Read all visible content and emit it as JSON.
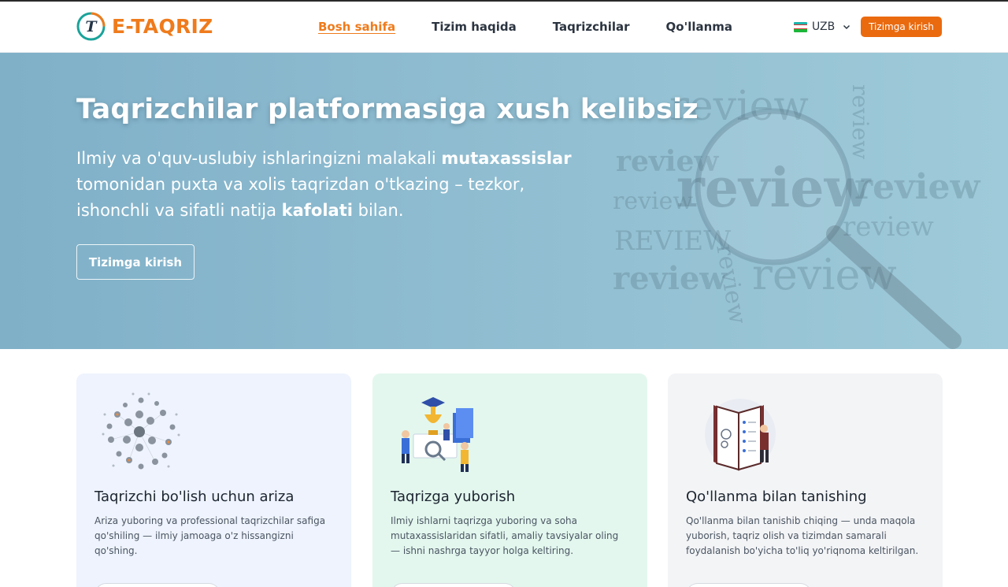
{
  "header": {
    "logo_letter": "T",
    "logo_text": "E-TAQRIZ",
    "nav": [
      {
        "label": "Bosh sahifa",
        "active": true
      },
      {
        "label": "Tizim haqida",
        "active": false
      },
      {
        "label": "Taqrizchilar",
        "active": false
      },
      {
        "label": "Qo'llanma",
        "active": false
      }
    ],
    "language": "UZB",
    "login_label": "Tizimga kirish"
  },
  "hero": {
    "title": "Taqrizchilar platformasiga xush kelibsiz",
    "subtitle_part1": "Ilmiy va o'quv-uslubiy ishlaringizni malakali ",
    "subtitle_bold1": "mutaxassislar",
    "subtitle_part2": " tomonidan puxta va xolis taqrizdan o'tkazing – tezkor, ishonchli va sifatli natija ",
    "subtitle_bold2": "kafolati",
    "subtitle_part3": " bilan.",
    "button_label": "Tizimga kirish",
    "art_words": [
      "review",
      "review",
      "review",
      "REVIEW",
      "review",
      "review",
      "review",
      "review",
      "review",
      "review"
    ]
  },
  "cards": [
    {
      "title": "Taqrizchi bo'lish uchun ariza",
      "description": "Ariza yuboring va professional taqrizchilar safiga qo'shiling — ilmiy jamoaga o'z hissangizni qo'shing."
    },
    {
      "title": "Taqrizga yuborish",
      "description": "Ilmiy ishlarni taqrizga yuboring va soha mutaxassislaridan sifatli, amaliy tavsiyalar oling — ishni nashrga tayyor holga keltiring."
    },
    {
      "title": "Qo'llanma bilan tanishing",
      "description": "Qo'llanma bilan tanishib chiqing — unda maqola yuborish, taqriz olish va tizimdan samarali foydalanish bo'yicha to'liq yo'riqnoma keltirilgan."
    }
  ],
  "colors": {
    "brand_orange": "#ea6a0f",
    "logo_teal": "#1aa39a",
    "hero_blue": "#8fbcd0",
    "card1_bg": "#eef3fd",
    "card2_bg": "#e3f7ee",
    "card3_bg": "#f3f4f6"
  },
  "icons": {
    "logo": "logo-icon",
    "flag": "uzbekistan-flag-icon",
    "chevron": "chevron-down-icon",
    "card1": "people-network-illustration",
    "card2": "team-achievement-illustration",
    "card3": "manual-book-illustration"
  }
}
